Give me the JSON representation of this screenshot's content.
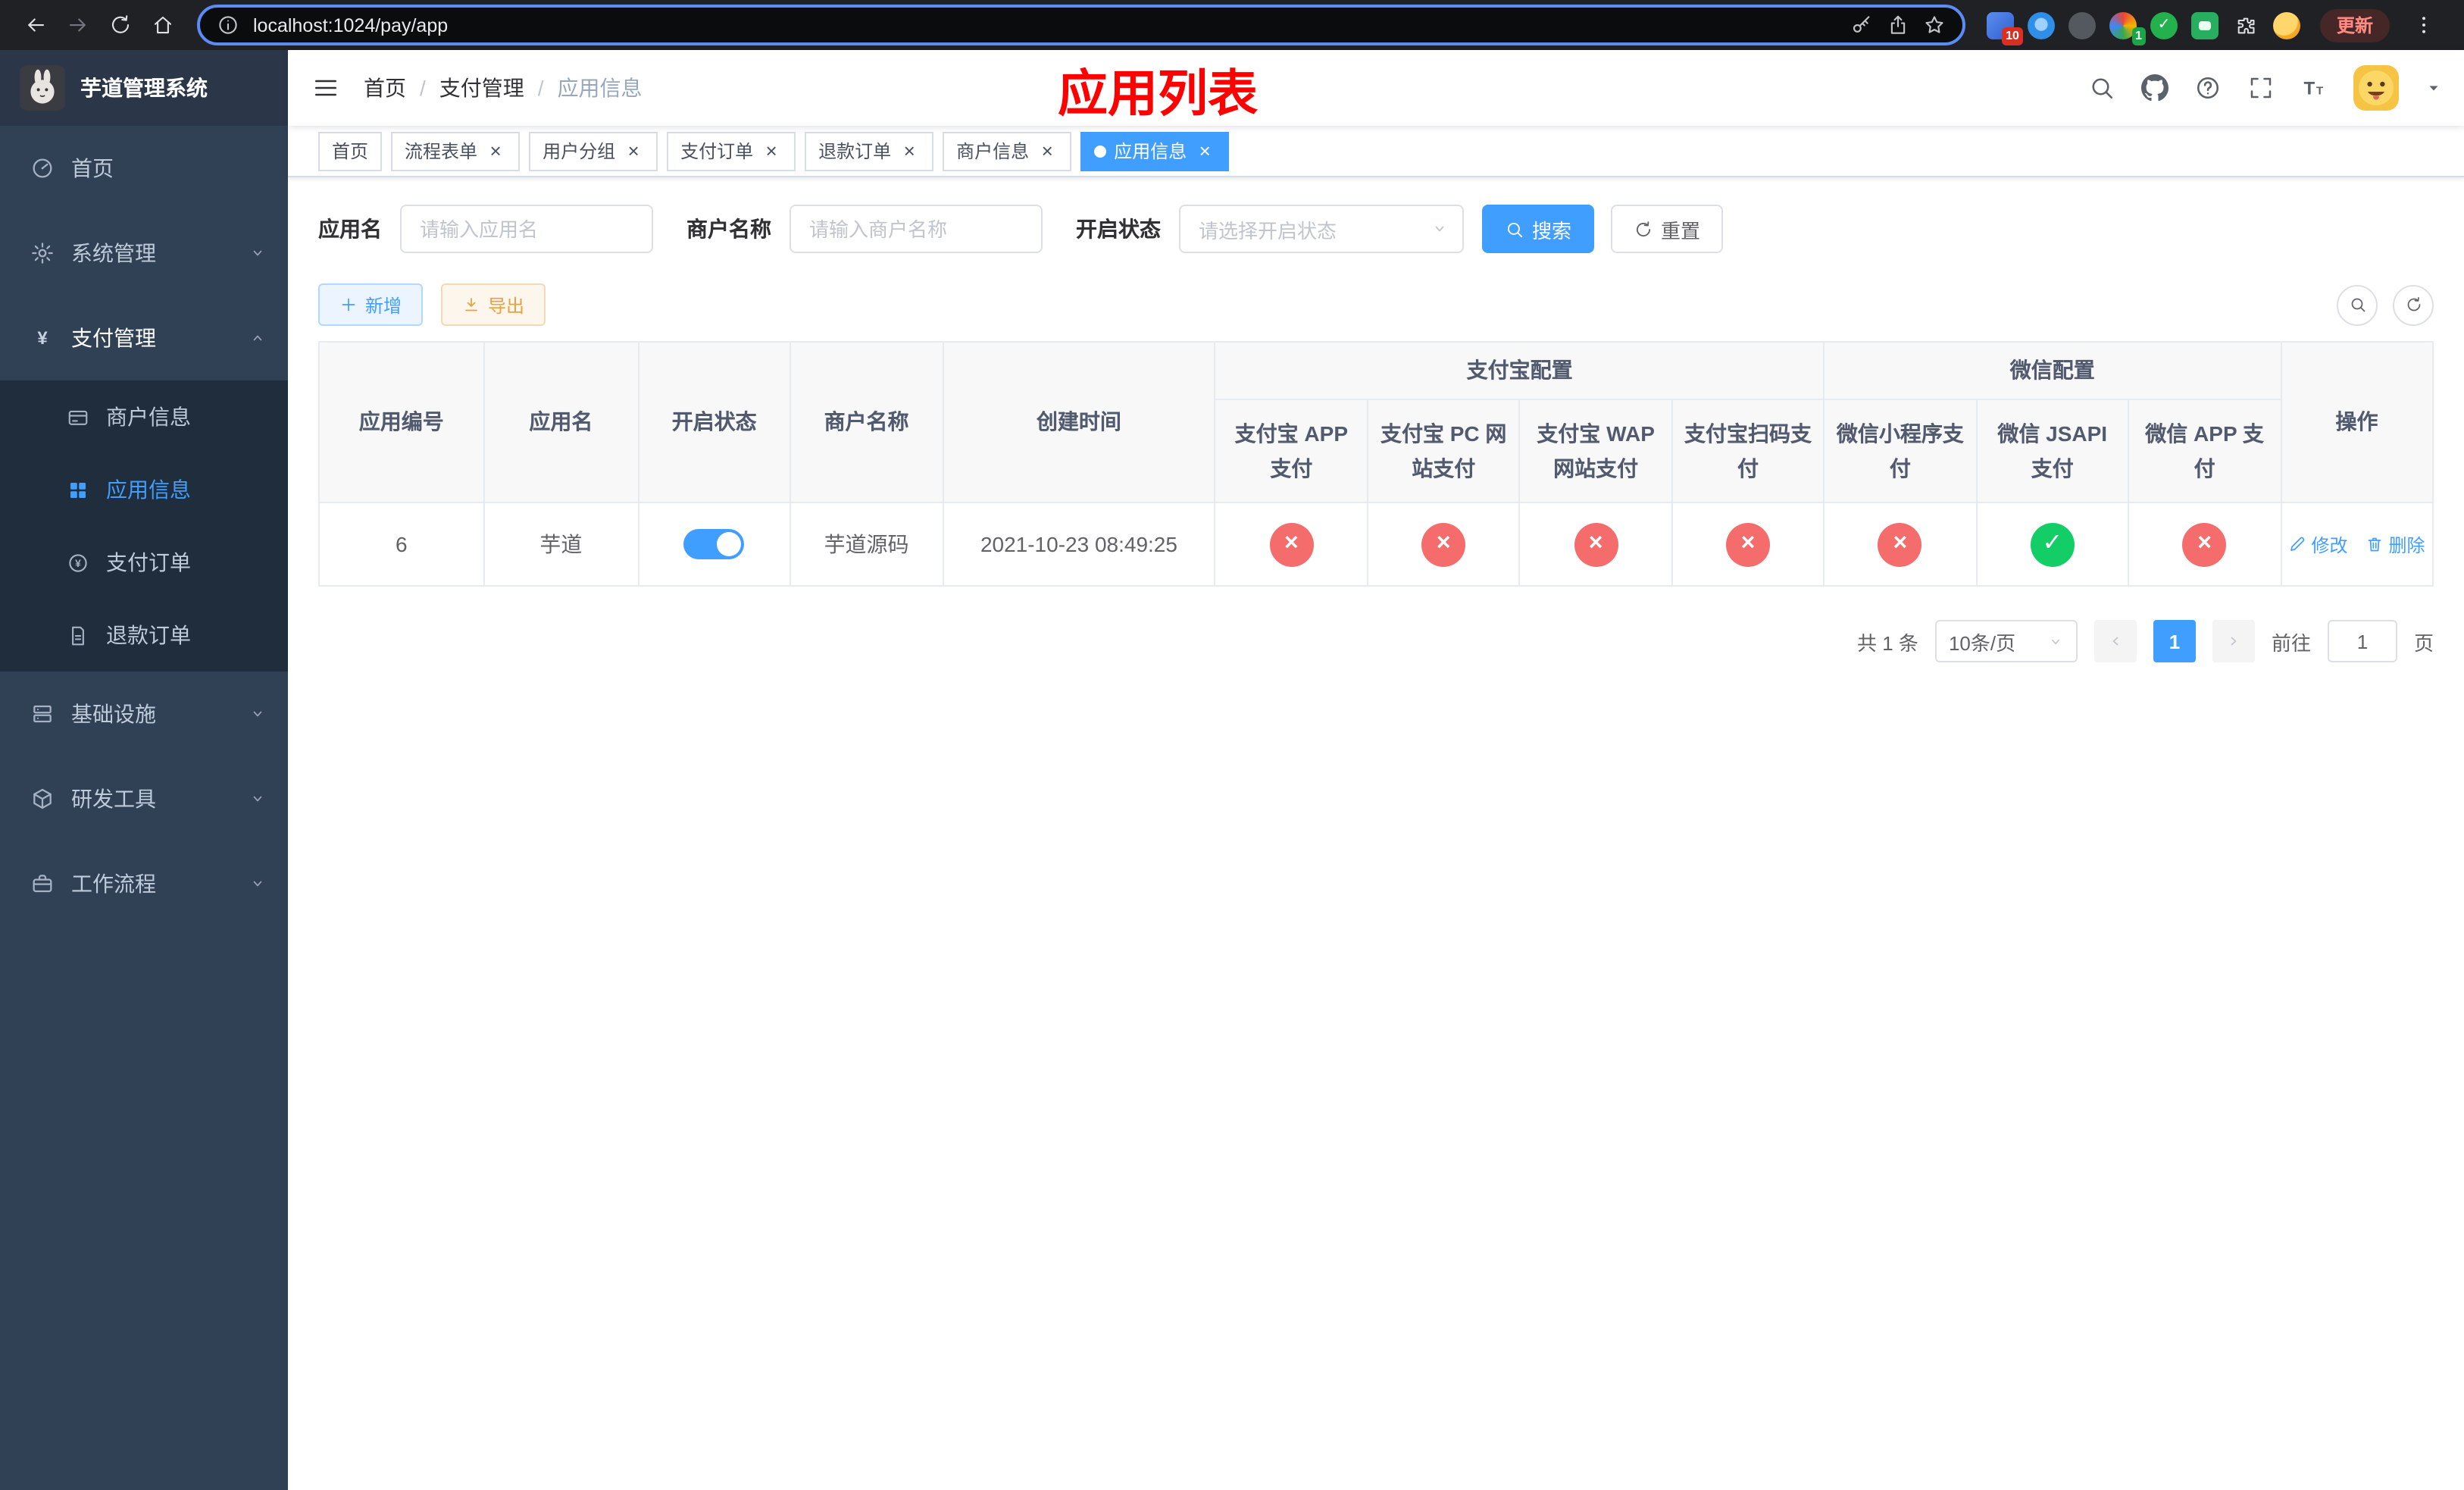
{
  "browser": {
    "url": "localhost:1024/pay/app",
    "update_label": "更新",
    "ext_badge_red": "10",
    "ext_badge_green": "1"
  },
  "sidebar": {
    "title": "芋道管理系统",
    "items": [
      {
        "label": "首页"
      },
      {
        "label": "系统管理"
      },
      {
        "label": "支付管理"
      },
      {
        "label": "基础设施"
      },
      {
        "label": "研发工具"
      },
      {
        "label": "工作流程"
      }
    ],
    "payment_children": [
      {
        "label": "商户信息"
      },
      {
        "label": "应用信息"
      },
      {
        "label": "支付订单"
      },
      {
        "label": "退款订单"
      }
    ]
  },
  "header": {
    "breadcrumb": [
      "首页",
      "支付管理",
      "应用信息"
    ],
    "separator": "/",
    "title": "应用列表"
  },
  "tabs": {
    "close_glyph": "×",
    "items": [
      {
        "label": "首页"
      },
      {
        "label": "流程表单"
      },
      {
        "label": "用户分组"
      },
      {
        "label": "支付订单"
      },
      {
        "label": "退款订单"
      },
      {
        "label": "商户信息"
      },
      {
        "label": "应用信息"
      }
    ]
  },
  "filters": {
    "app_name_label": "应用名",
    "app_name_placeholder": "请输入应用名",
    "merchant_label": "商户名称",
    "merchant_placeholder": "请输入商户名称",
    "status_label": "开启状态",
    "status_placeholder": "请选择开启状态",
    "search_label": "搜索",
    "reset_label": "重置"
  },
  "toolbar": {
    "add_label": "新增",
    "export_label": "导出"
  },
  "table": {
    "headers": {
      "app_id": "应用编号",
      "app_name": "应用名",
      "status": "开启状态",
      "merchant": "商户名称",
      "created": "创建时间",
      "alipay_group": "支付宝配置",
      "wechat_group": "微信配置",
      "ops": "操作",
      "sub": [
        "支付宝 APP 支付",
        "支付宝 PC 网站支付",
        "支付宝 WAP 网站支付",
        "支付宝扫码支付",
        "微信小程序支付",
        "微信 JSAPI 支付",
        "微信 APP 支付"
      ]
    },
    "rows": [
      {
        "app_id": "6",
        "app_name": "芋道",
        "status_on": true,
        "merchant": "芋道源码",
        "created": "2021-10-23 08:49:25",
        "statuses": [
          {
            "state": "fail",
            "glyph": "×"
          },
          {
            "state": "fail",
            "glyph": "×"
          },
          {
            "state": "fail",
            "glyph": "×"
          },
          {
            "state": "fail",
            "glyph": "×"
          },
          {
            "state": "fail",
            "glyph": "×"
          },
          {
            "state": "success",
            "glyph": "✓"
          },
          {
            "state": "fail",
            "glyph": "×"
          }
        ],
        "edit_label": "修改",
        "delete_label": "删除"
      }
    ]
  },
  "pagination": {
    "total": "共 1 条",
    "page_size": "10条/页",
    "current_page": "1",
    "goto_prefix": "前往",
    "goto_value": "1",
    "goto_suffix": "页"
  },
  "colors": {
    "accent": "#409eff",
    "danger": "#f56c6c",
    "success": "#13ce66",
    "warning": "#e6a23c",
    "title_red": "#ff0000",
    "sidebar_bg": "#304156",
    "submenu_bg": "#1f2d3d"
  }
}
